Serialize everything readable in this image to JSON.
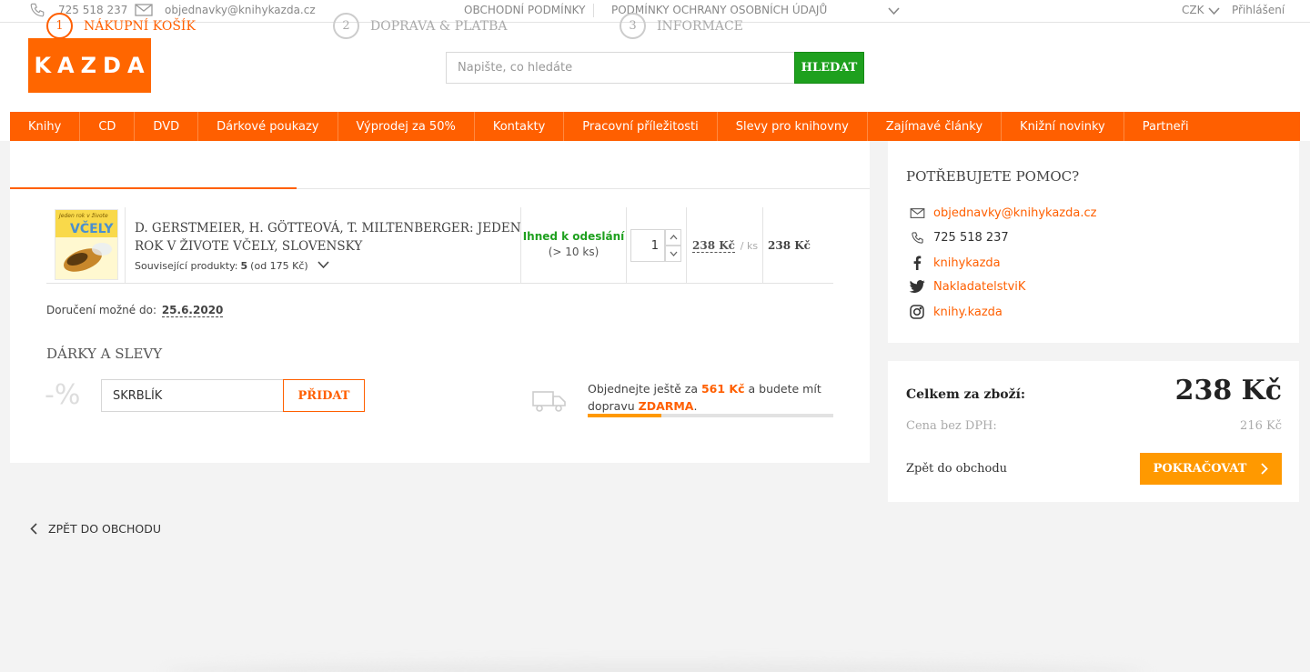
{
  "topbar": {
    "phone": "725 518 237",
    "email": "objednavky@knihykazda.cz",
    "links": [
      "OBCHODNÍ PODMÍNKY",
      "PODMÍNKY OCHRANY OSOBNÍCH ÚDAJŮ"
    ],
    "currency": "CZK",
    "login": "Přihlášení"
  },
  "header": {
    "logo": "KAZDA",
    "search_placeholder": "Napište, co hledáte",
    "search_button": "HLEDAT"
  },
  "nav": [
    "Knihy",
    "CD",
    "DVD",
    "Dárkové poukazy",
    "Výprodej za 50%",
    "Kontakty",
    "Pracovní příležitosti",
    "Slevy pro knihovny",
    "Zajímavé články",
    "Knižní novinky",
    "Partneři"
  ],
  "steps": [
    {
      "num": "1",
      "label": "NÁKUPNÍ KOŠÍK"
    },
    {
      "num": "2",
      "label": "DOPRAVA & PLATBA"
    },
    {
      "num": "3",
      "label": "INFORMACE"
    }
  ],
  "cart": {
    "item": {
      "cover_top": "Jeden rok v živote",
      "cover_title": "VČELY",
      "title_line1": "D. GERSTMEIER, H. GÖTTEOVÁ, T. MILTENBERGER: JEDEN",
      "title_line2": "ROK V ŽIVOTE VČELY, SLOVENSKY",
      "related_label": "Související produkty:",
      "related_count": "5",
      "related_from": "(od 175 Kč)",
      "availability": "Ihned k odeslání",
      "availability_sub": "(> 10 ks)",
      "quantity": "1",
      "unit_price": "238 Kč",
      "unit_suffix": "/ ks",
      "total": "238 Kč"
    },
    "delivery_label": "Doručení možné do:",
    "delivery_date": "25.6.2020",
    "gifts_heading": "DÁRKY A SLEVY",
    "percent_glyph": "-%",
    "coupon_value": "SKRBLÍK",
    "coupon_button": "PŘIDAT",
    "shipping_prefix": "Objednejte ještě za",
    "shipping_amount": "561 Kč",
    "shipping_mid": "a budete mít",
    "shipping_line2": "dopravu",
    "shipping_free": "ZDARMA",
    "shipping_end": ".",
    "shipping_progress": 0.3
  },
  "back_link": "ZPĚT DO OBCHODU",
  "help": {
    "heading": "POTŘEBUJETE POMOC?",
    "email": "objednavky@knihykazda.cz",
    "phone": "725 518 237",
    "facebook": "knihykazda",
    "twitter": "NakladatelstviK",
    "instagram": "knihy.kazda"
  },
  "summary": {
    "total_label": "Celkem za zboží:",
    "total": "238 Kč",
    "net_label": "Cena bez DPH:",
    "net": "216 Kč",
    "back": "Zpět do obchodu",
    "continue": "POKRAČOVAT"
  },
  "colors": {
    "accent": "#ff5f00",
    "green": "#1ea01e",
    "button": "#ff9900"
  }
}
